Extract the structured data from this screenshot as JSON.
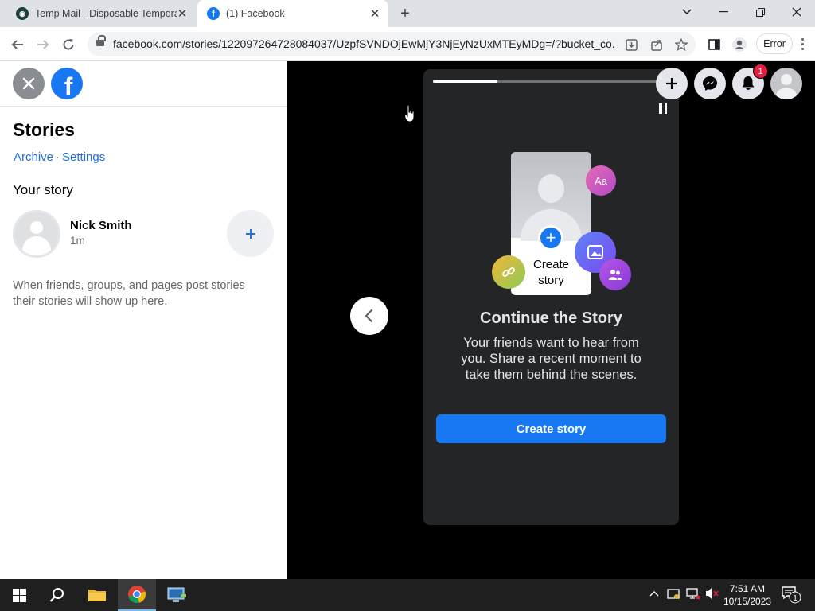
{
  "browser": {
    "tabs": [
      {
        "title": "Temp Mail - Disposable Tempora",
        "favicon": "temp-mail-icon"
      },
      {
        "title": "(1) Facebook",
        "favicon": "facebook-icon"
      }
    ],
    "url": "facebook.com/stories/122097264728084037/UzpfSVNDOjEwMjY3NjEyNzUxMTEyMDg=/?bucket_co...",
    "error_chip": "Error"
  },
  "left_panel": {
    "title": "Stories",
    "links": [
      "Archive",
      "Settings"
    ],
    "your_story_label": "Your story",
    "story": {
      "name": "Nick Smith",
      "time": "1m"
    },
    "empty_message": "When friends, groups, and pages post stories their stories will show up here."
  },
  "viewer": {
    "progress_fraction": 0.28,
    "illustration": {
      "create_caption_line1": "Create",
      "create_caption_line2": "story",
      "text_bubble": "Aa"
    },
    "heading": "Continue the Story",
    "body": "Your friends want to hear from you. Share a recent moment to take them behind the scenes.",
    "button": "Create story",
    "notification_count": "1"
  },
  "taskbar": {
    "time": "7:51 AM",
    "date": "10/15/2023",
    "notification_count": "1"
  },
  "colors": {
    "facebook_blue": "#1877f2",
    "link_blue": "#216fdb",
    "card_bg": "#242526",
    "badge_red": "#e41e3f"
  }
}
